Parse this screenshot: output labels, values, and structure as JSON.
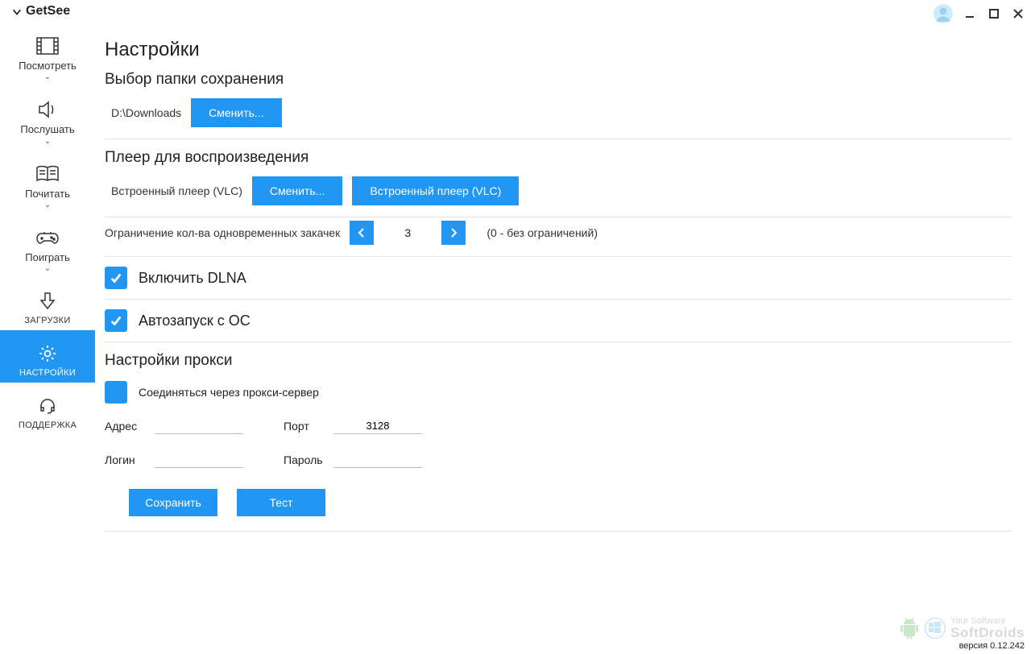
{
  "app": {
    "name": "GetSee"
  },
  "window": {
    "min": "minimize",
    "max": "maximize",
    "close": "close"
  },
  "sidebar": [
    {
      "id": "watch",
      "label": "Посмотреть",
      "chevron": true
    },
    {
      "id": "listen",
      "label": "Послушать",
      "chevron": true
    },
    {
      "id": "read",
      "label": "Почитать",
      "chevron": true
    },
    {
      "id": "play",
      "label": "Поиграть",
      "chevron": true
    },
    {
      "id": "downloads",
      "label": "ЗАГРУЗКИ",
      "chevron": false,
      "small": true
    },
    {
      "id": "settings",
      "label": "НАСТРОЙКИ",
      "chevron": false,
      "small": true,
      "active": true
    },
    {
      "id": "support",
      "label": "ПОДДЕРЖКА",
      "chevron": false,
      "small": true
    }
  ],
  "page": {
    "title": "Настройки"
  },
  "save_folder": {
    "heading": "Выбор папки сохранения",
    "path": "D:\\Downloads",
    "change_btn": "Сменить..."
  },
  "player": {
    "heading": "Плеер для воспроизведения",
    "current": "Встроенный плеер (VLC)",
    "change_btn": "Сменить...",
    "builtin_btn": "Встроенный плеер (VLC)"
  },
  "download_limit": {
    "label": "Ограничение кол-ва одновременных закачек",
    "value": "3",
    "hint": "(0 - без ограничений)"
  },
  "checks": {
    "dlna": "Включить DLNA",
    "autostart": "Автозапуск с ОС"
  },
  "proxy": {
    "heading": "Настройки прокси",
    "use_proxy_label": "Соединяться через прокси-сервер",
    "address_label": "Адрес",
    "address_value": "",
    "port_label": "Порт",
    "port_value": "3128",
    "login_label": "Логин",
    "login_value": "",
    "password_label": "Пароль",
    "password_value": "",
    "save_btn": "Сохранить",
    "test_btn": "Тест"
  },
  "footer": {
    "brand_line1": "Your Software",
    "brand_line2": "SoftDroids",
    "version": "версия 0.12.242"
  }
}
